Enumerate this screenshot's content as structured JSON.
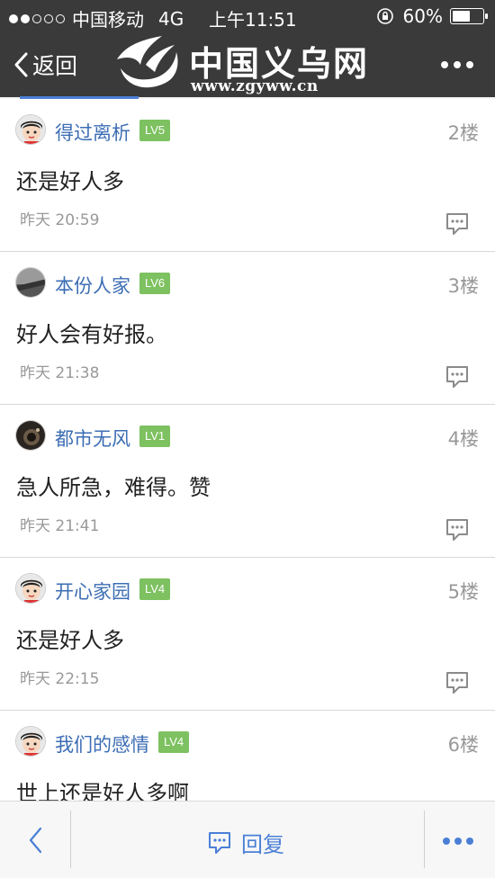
{
  "status_bar": {
    "carrier": "中国移动",
    "network": "4G",
    "time": "上午11:51",
    "battery": "60%",
    "battery_level": 0.6
  },
  "nav": {
    "back_label": "返回",
    "logo_title": "中国义乌网",
    "logo_url": "www.zgyww.cn"
  },
  "comments": [
    {
      "username": "得过离析",
      "level": "LV5",
      "floor": "2楼",
      "content": "还是好人多",
      "time": "昨天 20:59",
      "avatar": "cartoon-boy"
    },
    {
      "username": "本份人家",
      "level": "LV6",
      "floor": "3楼",
      "content": "好人会有好报。",
      "time": "昨天 21:38",
      "avatar": "photo-gray"
    },
    {
      "username": "都市无风",
      "level": "LV1",
      "floor": "4楼",
      "content": "急人所急，难得。赞",
      "time": "昨天 21:41",
      "avatar": "photo-dark"
    },
    {
      "username": "开心家园",
      "level": "LV4",
      "floor": "5楼",
      "content": "还是好人多",
      "time": "昨天 22:15",
      "avatar": "cartoon-boy"
    },
    {
      "username": "我们的感情",
      "level": "LV4",
      "floor": "6楼",
      "content": "世上还是好人多啊",
      "time": "",
      "avatar": "cartoon-boy"
    }
  ],
  "bottom_bar": {
    "reply_label": "回复"
  },
  "colors": {
    "header_bg": "#3a3a3a",
    "link_blue": "#3c6db4",
    "level_green": "#7dc160",
    "accent_blue": "#4a7fd6"
  }
}
